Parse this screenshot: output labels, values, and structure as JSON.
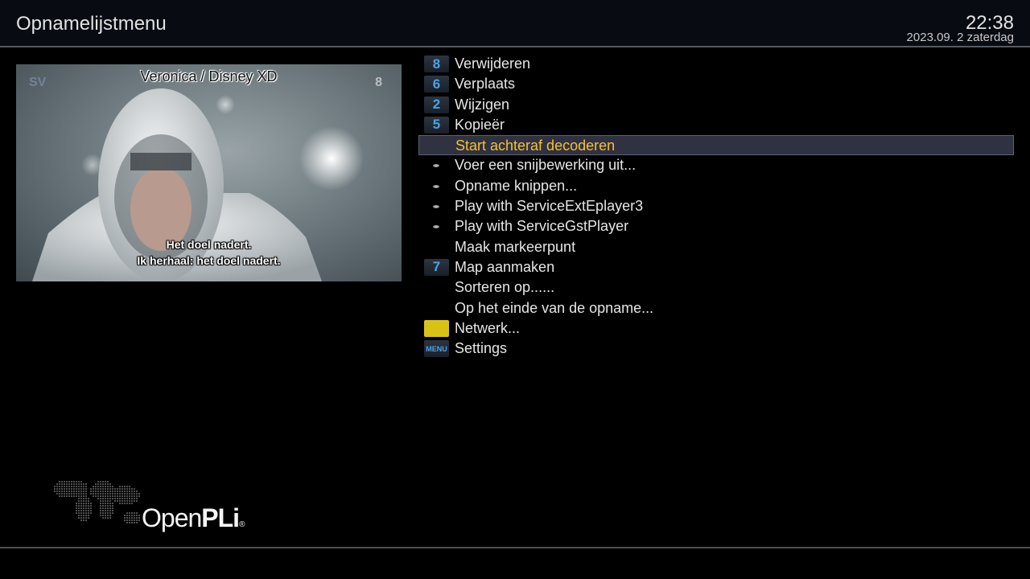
{
  "header": {
    "title": "Opnamelijstmenu",
    "clock": "22:38",
    "date": "2023.09. 2 zaterdag"
  },
  "preview": {
    "channel_name": "Veronica / Disney XD",
    "channel_number": "8",
    "channel_logo": "SV",
    "subtitle_line1": "Het doel nadert.",
    "subtitle_line2": "Ik herhaal: het doel nadert."
  },
  "menu": {
    "items": [
      {
        "key": "8",
        "key_type": "number",
        "label": "Verwijderen"
      },
      {
        "key": "6",
        "key_type": "number",
        "label": "Verplaats"
      },
      {
        "key": "2",
        "key_type": "number",
        "label": "Wijzigen"
      },
      {
        "key": "5",
        "key_type": "number",
        "label": "Kopieër"
      },
      {
        "key": "",
        "key_type": "none",
        "label": "Start achteraf decoderen",
        "selected": true
      },
      {
        "key": "",
        "key_type": "dot",
        "label": "Voer een snijbewerking uit..."
      },
      {
        "key": "",
        "key_type": "dot",
        "label": "Opname knippen..."
      },
      {
        "key": "",
        "key_type": "dot",
        "label": "Play with ServiceExtEplayer3"
      },
      {
        "key": "",
        "key_type": "dot",
        "label": "Play with ServiceGstPlayer"
      },
      {
        "key": "",
        "key_type": "none",
        "label": "Maak markeerpunt"
      },
      {
        "key": "7",
        "key_type": "number",
        "label": "Map aanmaken"
      },
      {
        "key": "",
        "key_type": "none",
        "label": "Sorteren op......"
      },
      {
        "key": "",
        "key_type": "none",
        "label": "Op het einde van de opname..."
      },
      {
        "key": "",
        "key_type": "yellow",
        "label": "Netwerk..."
      },
      {
        "key": "MENU",
        "key_type": "menu",
        "label": "Settings"
      }
    ]
  },
  "branding": {
    "name_light": "Open",
    "name_bold": "PLi",
    "registered": "®"
  },
  "colors": {
    "selected_text": "#f5c030",
    "key_number": "#4aa3e6",
    "yellow_button": "#d8c216",
    "selection_bg": "#303241"
  }
}
